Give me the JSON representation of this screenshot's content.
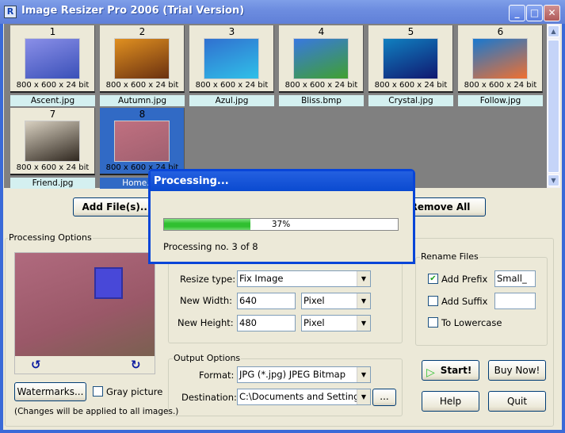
{
  "window": {
    "title": "Image Resizer Pro 2006 (Trial Version)",
    "icon": "R",
    "minimize": "_",
    "maximize": "□",
    "close": "✕"
  },
  "gallery": {
    "items": [
      {
        "num": "1",
        "info": "800 x 600 x 24 bit",
        "name": "Ascent.jpg",
        "colors": [
          "#8a8fe8",
          "#3a50b8"
        ],
        "selected": false
      },
      {
        "num": "2",
        "info": "800 x 600 x 24 bit",
        "name": "Autumn.jpg",
        "colors": [
          "#e09020",
          "#6a3010"
        ],
        "selected": false
      },
      {
        "num": "3",
        "info": "800 x 600 x 24 bit",
        "name": "Azul.jpg",
        "colors": [
          "#3070d0",
          "#30c0e8"
        ],
        "selected": false
      },
      {
        "num": "4",
        "info": "800 x 600 x 24 bit",
        "name": "Bliss.bmp",
        "colors": [
          "#3878e0",
          "#40a030"
        ],
        "selected": false
      },
      {
        "num": "5",
        "info": "800 x 600 x 24 bit",
        "name": "Crystal.jpg",
        "colors": [
          "#1080c0",
          "#101870"
        ],
        "selected": false
      },
      {
        "num": "6",
        "info": "800 x 600 x 24 bit",
        "name": "Follow.jpg",
        "colors": [
          "#1878d0",
          "#f07030"
        ],
        "selected": false
      },
      {
        "num": "7",
        "info": "800 x 600 x 24 bit",
        "name": "Friend.jpg",
        "colors": [
          "#d8d0c0",
          "#302820"
        ],
        "selected": false
      },
      {
        "num": "8",
        "info": "800 x 600 x 24 bit",
        "name": "Home.jpg",
        "colors": [
          "#c07080",
          "#a06070"
        ],
        "selected": true
      }
    ]
  },
  "buttons": {
    "add_files": "Add File(s)...",
    "remove_all": "Remove All",
    "watermarks": "Watermarks...",
    "start": "Start!",
    "buy_now": "Buy Now!",
    "help": "Help",
    "quit": "Quit",
    "browse": "..."
  },
  "processing_options": {
    "label": "Processing Options",
    "gray_picture": "Gray picture",
    "gray_checked": false,
    "note": "(Changes will be applied to all images.)",
    "rotate_left": "↺",
    "rotate_right": "↻"
  },
  "resize": {
    "type_label": "Resize type:",
    "type_value": "Fix Image",
    "width_label": "New Width:",
    "width_value": "640",
    "width_unit": "Pixel",
    "height_label": "New Height:",
    "height_value": "480",
    "height_unit": "Pixel"
  },
  "output": {
    "label": "Output Options",
    "format_label": "Format:",
    "format_value": "JPG (*.jpg) JPEG Bitmap",
    "dest_label": "Destination:",
    "dest_value": "C:\\Documents and Setting"
  },
  "rename": {
    "label": "Rename Files",
    "add_prefix": "Add Prefix",
    "prefix_checked": true,
    "prefix_value": "Small_",
    "add_suffix": "Add Suffix",
    "suffix_checked": false,
    "suffix_value": "",
    "lowercase": "To Lowercase",
    "lowercase_checked": false
  },
  "dialog": {
    "title": "Processing...",
    "progress_percent": 37,
    "progress_text": "37%",
    "status": "Processing no. 3 of 8"
  }
}
